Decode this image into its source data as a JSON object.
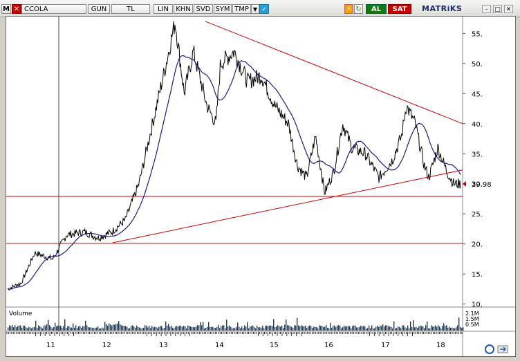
{
  "toolbar": {
    "m_label": "M",
    "symbol": "CCOLA",
    "period": "GUN",
    "currency": "TL",
    "buttons": [
      "LIN",
      "KHN",
      "SVD",
      "SYM",
      "TMP"
    ],
    "buy": "AL",
    "sell": "SAT",
    "brand": "MATRiKS"
  },
  "colors": {
    "price": "#000000",
    "average": "#1a1a8c",
    "lines": "#cc0000",
    "volume": "#153e6e",
    "price_tag": "#cc0000"
  },
  "chart_data": {
    "type": "line",
    "ylim": [
      9.5,
      57.8
    ],
    "yticks": [
      "10.",
      "15.",
      "20.",
      "25.",
      "30.",
      "35.",
      "40.",
      "45.",
      "50.",
      "55."
    ],
    "ytick_values": [
      10,
      15,
      20,
      25,
      30,
      35,
      40,
      45,
      50,
      55
    ],
    "last_price": "29.98",
    "xticks": [
      "11",
      "12",
      "13",
      "14",
      "15",
      "16",
      "17",
      "18"
    ],
    "volume_label": "Volume",
    "volume_ticks": [
      "2.1M",
      "1.5M",
      "0.5M"
    ],
    "price_keys": [
      [
        0,
        12.5
      ],
      [
        0.03,
        13.5
      ],
      [
        0.06,
        18.5
      ],
      [
        0.1,
        17.5
      ],
      [
        0.13,
        21.5
      ],
      [
        0.17,
        22
      ],
      [
        0.2,
        21
      ],
      [
        0.23,
        22
      ],
      [
        0.26,
        24
      ],
      [
        0.29,
        30
      ],
      [
        0.32,
        40
      ],
      [
        0.35,
        50
      ],
      [
        0.37,
        57
      ],
      [
        0.39,
        45
      ],
      [
        0.41,
        52
      ],
      [
        0.44,
        43
      ],
      [
        0.46,
        40
      ],
      [
        0.47,
        50
      ],
      [
        0.5,
        52
      ],
      [
        0.53,
        47
      ],
      [
        0.56,
        48
      ],
      [
        0.59,
        43
      ],
      [
        0.62,
        40
      ],
      [
        0.64,
        33
      ],
      [
        0.66,
        31
      ],
      [
        0.68,
        38
      ],
      [
        0.7,
        28.5
      ],
      [
        0.72,
        32
      ],
      [
        0.74,
        40
      ],
      [
        0.76,
        36
      ],
      [
        0.79,
        35
      ],
      [
        0.82,
        31
      ],
      [
        0.85,
        34
      ],
      [
        0.87,
        38
      ],
      [
        0.88,
        43
      ],
      [
        0.9,
        40
      ],
      [
        0.92,
        33
      ],
      [
        0.93,
        31
      ],
      [
        0.95,
        36
      ],
      [
        0.97,
        32
      ],
      [
        0.985,
        30
      ]
    ]
  }
}
